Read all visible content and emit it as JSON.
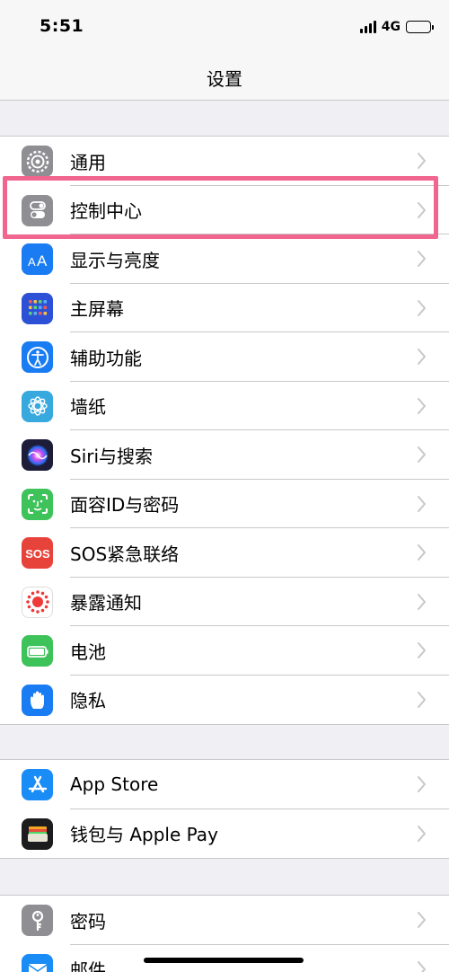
{
  "status": {
    "time": "5:51",
    "network": "4G"
  },
  "nav": {
    "title": "设置"
  },
  "groups": [
    [
      {
        "label": "通用",
        "icon": "gear-icon",
        "color": "#8e8e93"
      },
      {
        "label": "控制中心",
        "icon": "toggles-icon",
        "color": "#8e8e93"
      },
      {
        "label": "显示与亮度",
        "icon": "text-size-icon",
        "color": "#1a7cf2"
      },
      {
        "label": "主屏幕",
        "icon": "home-grid-icon",
        "color": "#2c51d6"
      },
      {
        "label": "辅助功能",
        "icon": "accessibility-icon",
        "color": "#1a7cf2"
      },
      {
        "label": "墙纸",
        "icon": "flower-icon",
        "color": "#38a9de"
      },
      {
        "label": "Siri与搜索",
        "icon": "siri-icon",
        "color": "#1d1d3a"
      },
      {
        "label": "面容ID与密码",
        "icon": "face-id-icon",
        "color": "#3ec25a"
      },
      {
        "label": "SOS紧急联络",
        "icon": "sos-icon",
        "color": "#e8433b"
      },
      {
        "label": "暴露通知",
        "icon": "exposure-icon",
        "color": "#ffffff"
      },
      {
        "label": "电池",
        "icon": "battery-icon",
        "color": "#3ec25a"
      },
      {
        "label": "隐私",
        "icon": "hand-icon",
        "color": "#1a7cf2"
      }
    ],
    [
      {
        "label": "App Store",
        "icon": "app-store-icon",
        "color": "#1a8cf6"
      },
      {
        "label": "钱包与 Apple Pay",
        "icon": "wallet-icon",
        "color": "#1c1c1e"
      }
    ],
    [
      {
        "label": "密码",
        "icon": "key-icon",
        "color": "#8e8e93"
      },
      {
        "label": "邮件",
        "icon": "mail-icon",
        "color": "#1a8cf6"
      }
    ]
  ]
}
